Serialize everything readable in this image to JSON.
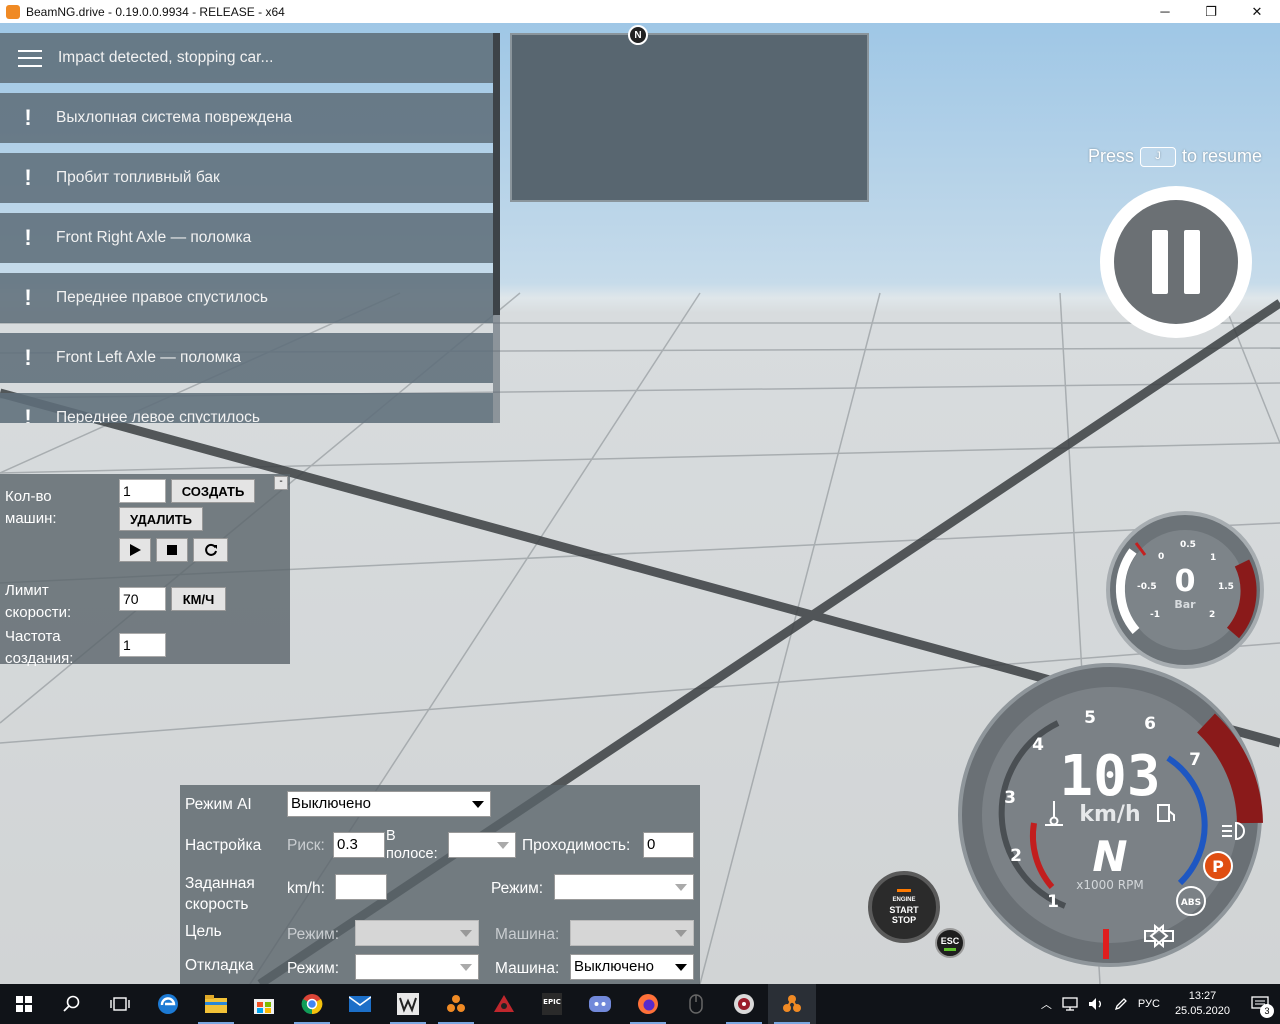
{
  "window": {
    "title": "BeamNG.drive - 0.19.0.0.9934 - RELEASE - x64",
    "minimize_glyph": "─",
    "restore_glyph": "❐",
    "close_glyph": "✕"
  },
  "notifications": {
    "header": "Impact detected, stopping car...",
    "items": [
      "Выхлопная система повреждена",
      "Пробит топливный бак",
      "Front Right Axle — поломка",
      "Переднее правое спустилось",
      "Front Left Axle — поломка",
      "Переднее левое спустилось"
    ],
    "item_icon": "!"
  },
  "minimap": {
    "north_label": "N"
  },
  "pause": {
    "press": "Press",
    "key": "J",
    "to_resume": "to resume"
  },
  "traffic": {
    "count_label_1": "Кол-во",
    "count_label_2": "машин:",
    "count_value": "1",
    "create_label": "СОЗДАТЬ",
    "delete_label": "УДАЛИТЬ",
    "collapse_label": "-",
    "speed_label_1": "Лимит",
    "speed_label_2": "скорости:",
    "speed_value": "70",
    "speed_unit": "КМ/Ч",
    "rate_label_1": "Частота",
    "rate_label_2": "создания:",
    "rate_value": "1"
  },
  "ai": {
    "mode_label": "Режим AI",
    "mode_value": "Выключено",
    "setup_label": "Настройка",
    "risk_label": "Риск:",
    "risk_value": "0.3",
    "lane_label_1": "В",
    "lane_label_2": "полосе:",
    "drivability_label": "Проходимость:",
    "drivability_value": "0",
    "speed_label_1": "Заданная",
    "speed_label_2": "скорость",
    "kmh_label": "km/h:",
    "speed_mode_label": "Режим:",
    "target_label": "Цель",
    "target_mode_label": "Режим:",
    "target_vehicle_label": "Машина:",
    "debug_label": "Откладка",
    "debug_mode_label": "Режим:",
    "debug_vehicle_label": "Машина:",
    "debug_vehicle_value": "Выключено"
  },
  "boost_gauge": {
    "value": "0",
    "unit": "Bar",
    "ticks": [
      "-1",
      "-0.5",
      "0",
      "0.5",
      "1",
      "1.5",
      "2"
    ]
  },
  "tacho": {
    "speed": "103",
    "speed_unit": "km/h",
    "gear": "N",
    "rpm_unit": "x1000 RPM",
    "rpm_ticks": [
      "1",
      "2",
      "3",
      "4",
      "5",
      "6",
      "7"
    ],
    "parking_label": "P",
    "abs_label": "ABS"
  },
  "engine_button": {
    "line1": "ENGINE",
    "line2": "START",
    "line3": "STOP"
  },
  "esc_button": {
    "label": "ESC"
  },
  "taskbar": {
    "language": "РУС",
    "time": "13:27",
    "date": "25.05.2020",
    "notification_count": "3"
  }
}
